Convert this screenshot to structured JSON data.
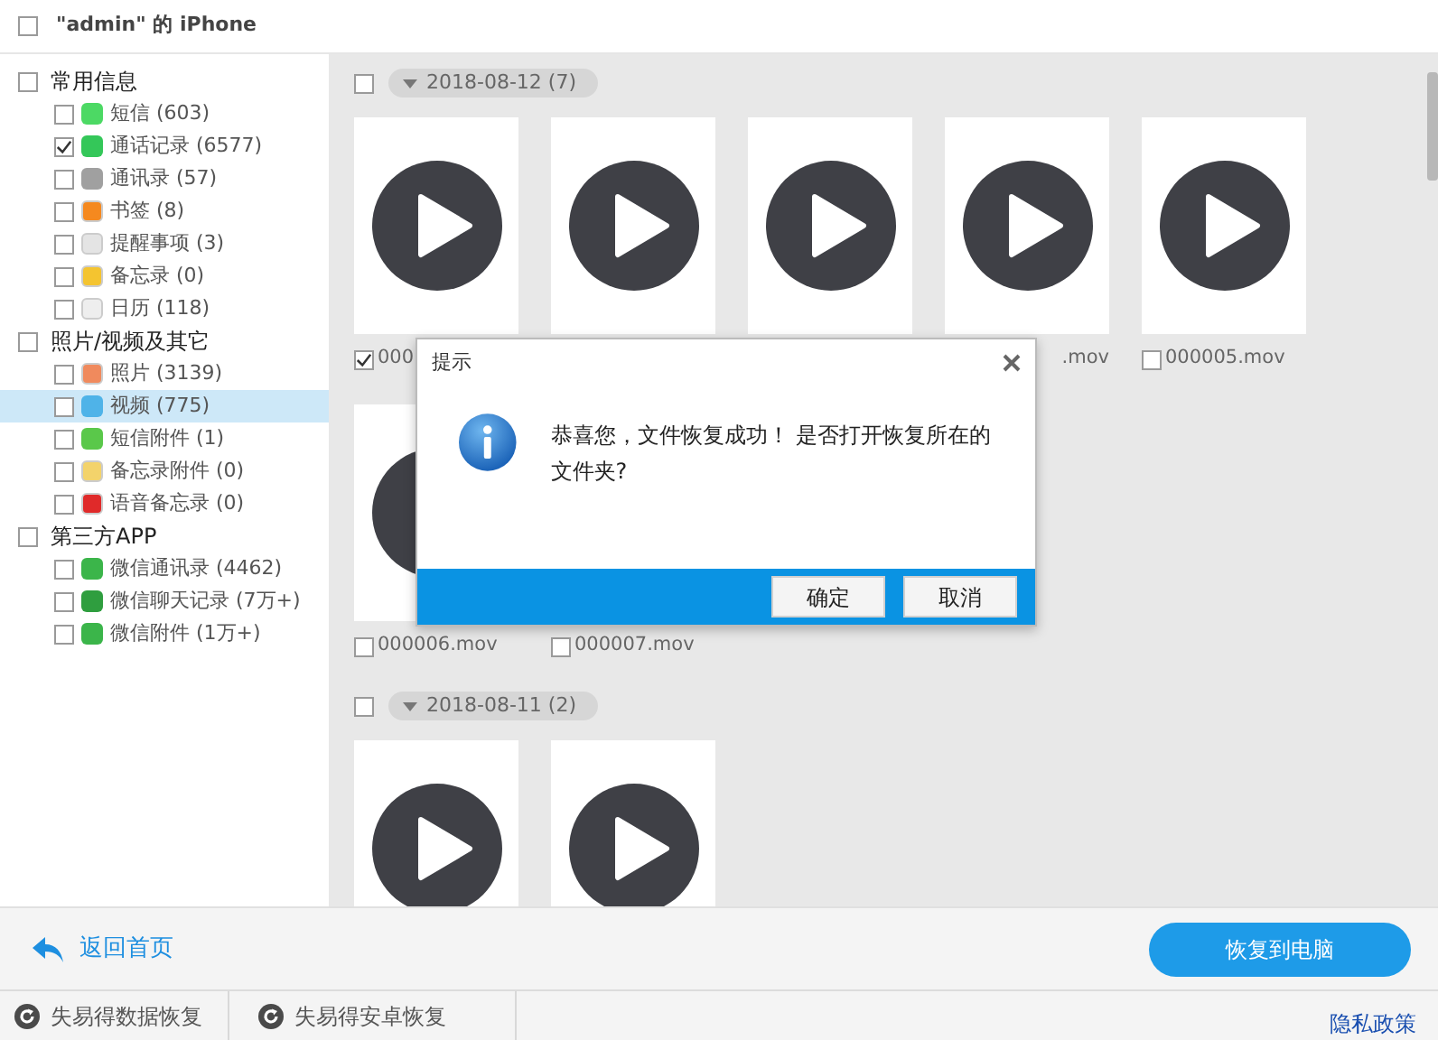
{
  "window": {
    "title": "\"admin\" 的 iPhone",
    "checked": false
  },
  "sidebar": {
    "groups": [
      {
        "label": "常用信息",
        "checked": false,
        "items": [
          {
            "label": "短信 (603)",
            "checked": false,
            "selected": false,
            "color": "#4cd964"
          },
          {
            "label": "通话记录 (6577)",
            "checked": true,
            "selected": false,
            "color": "#34c759"
          },
          {
            "label": "通讯录 (57)",
            "checked": false,
            "selected": false,
            "color": "#a0a0a0"
          },
          {
            "label": "书签 (8)",
            "checked": false,
            "selected": false,
            "color": "#f5891f"
          },
          {
            "label": "提醒事项 (3)",
            "checked": false,
            "selected": false,
            "color": "#e4e4e4"
          },
          {
            "label": "备忘录 (0)",
            "checked": false,
            "selected": false,
            "color": "#f4c430"
          },
          {
            "label": "日历 (118)",
            "checked": false,
            "selected": false,
            "color": "#eeeeee"
          }
        ]
      },
      {
        "label": "照片/视频及其它",
        "checked": false,
        "items": [
          {
            "label": "照片 (3139)",
            "checked": false,
            "selected": false,
            "color": "#f08a5d"
          },
          {
            "label": "视频 (775)",
            "checked": false,
            "selected": true,
            "color": "#4fb3e8"
          },
          {
            "label": "短信附件 (1)",
            "checked": false,
            "selected": false,
            "color": "#5ac84a"
          },
          {
            "label": "备忘录附件 (0)",
            "checked": false,
            "selected": false,
            "color": "#f3d36b"
          },
          {
            "label": "语音备忘录 (0)",
            "checked": false,
            "selected": false,
            "color": "#e02a2a"
          }
        ]
      },
      {
        "label": "第三方APP",
        "checked": false,
        "items": [
          {
            "label": "微信通讯录 (4462)",
            "checked": false,
            "selected": false,
            "color": "#3bb54a"
          },
          {
            "label": "微信聊天记录 (7万+)",
            "checked": false,
            "selected": false,
            "color": "#2f9e3f"
          },
          {
            "label": "微信附件 (1万+)",
            "checked": false,
            "selected": false,
            "color": "#3bb54a"
          }
        ]
      }
    ]
  },
  "content": {
    "groups": [
      {
        "label": "2018-08-12 (7)",
        "checked": false,
        "videos": [
          {
            "kind": "labeled",
            "label": "000",
            "checked": true
          },
          {
            "kind": "bare"
          },
          {
            "kind": "bare"
          },
          {
            "kind": "cut_left",
            "label": ".mov"
          },
          {
            "kind": "labeled",
            "label": "000005.mov",
            "checked": false
          },
          {
            "kind": "labeled",
            "label": "000006.mov",
            "checked": false
          },
          {
            "kind": "label_only",
            "label": "000007.mov",
            "checked": false
          }
        ]
      },
      {
        "label": "2018-08-11 (2)",
        "checked": false,
        "videos": [
          {
            "kind": "bare"
          },
          {
            "kind": "bare"
          }
        ]
      }
    ]
  },
  "dialog": {
    "title": "提示",
    "message": "恭喜您，文件恢复成功！ 是否打开恢复所在的文件夹?",
    "buttons": [
      "确定",
      "取消"
    ]
  },
  "back_link": "返回首页",
  "recover_button": "恢复到电脑",
  "footer": {
    "tabs": [
      "失易得数据恢复",
      "失易得安卓恢复"
    ],
    "privacy_link": "隐私政策"
  }
}
